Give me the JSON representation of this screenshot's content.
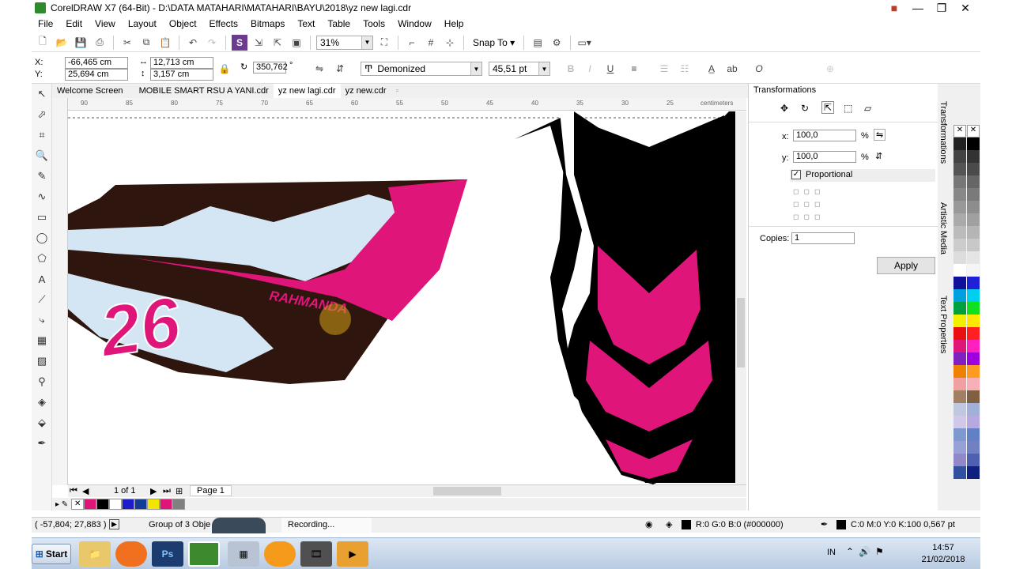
{
  "title": "CorelDRAW X7 (64-Bit) - D:\\DATA MATAHARI\\MATAHARI\\BAYU\\2018\\yz new lagi.cdr",
  "menu": [
    "File",
    "Edit",
    "View",
    "Layout",
    "Object",
    "Effects",
    "Bitmaps",
    "Text",
    "Table",
    "Tools",
    "Window",
    "Help"
  ],
  "standard": {
    "zoom": "31%",
    "snap_label": "Snap To"
  },
  "props": {
    "x_label": "X:",
    "x": "-66,465 cm",
    "y_label": "Y:",
    "y": "25,694 cm",
    "w": "12,713 cm",
    "h": "3,157 cm",
    "angle": "350,762",
    "angle_unit": "°",
    "font": "Demonized",
    "font_size": "45,51 pt"
  },
  "tabs": [
    "Welcome Screen",
    "MOBILE SMART RSU A YANI.cdr",
    "yz new lagi.cdr",
    "yz new.cdr"
  ],
  "ruler": {
    "ticks": [
      "90",
      "85",
      "80",
      "75",
      "70",
      "65",
      "60",
      "55",
      "50",
      "45",
      "40",
      "35",
      "30",
      "25",
      "20"
    ],
    "unit": "centimeters"
  },
  "canvas": {
    "number": "26",
    "name_text": "RAHMANDA"
  },
  "page_nav": {
    "count": "1 of 1",
    "page_tab": "Page 1"
  },
  "docker": {
    "title": "Transformations",
    "x_label": "x:",
    "x_value": "100,0",
    "y_label": "y:",
    "y_value": "100,0",
    "percent": "%",
    "proportional": "Proportional",
    "copies_label": "Copies:",
    "copies": "1",
    "apply": "Apply",
    "side_tabs": [
      "Transformations",
      "Artistic Media",
      "Text Properties"
    ]
  },
  "status": {
    "coords": "( -57,804; 27,883 )",
    "selection": "Group of 3 Obje",
    "recording": "Recording...",
    "fill": "R:0 G:0 B:0 (#000000)",
    "outline": "C:0 M:0 Y:0 K:100  0,567 pt"
  },
  "taskbar": {
    "start": "Start",
    "lang": "IN",
    "time": "14:57",
    "date": "21/02/2018"
  },
  "colors": {
    "magenta": "#e0157a",
    "darkbrown": "#2e150e",
    "lightblue": "#d4e6f3",
    "black": "#000000"
  },
  "palette": [
    "#e0157a",
    "#000000",
    "#ffffff",
    "#1c1cc8",
    "#123c96",
    "#f2e600",
    "#e0157a",
    "#808080"
  ]
}
